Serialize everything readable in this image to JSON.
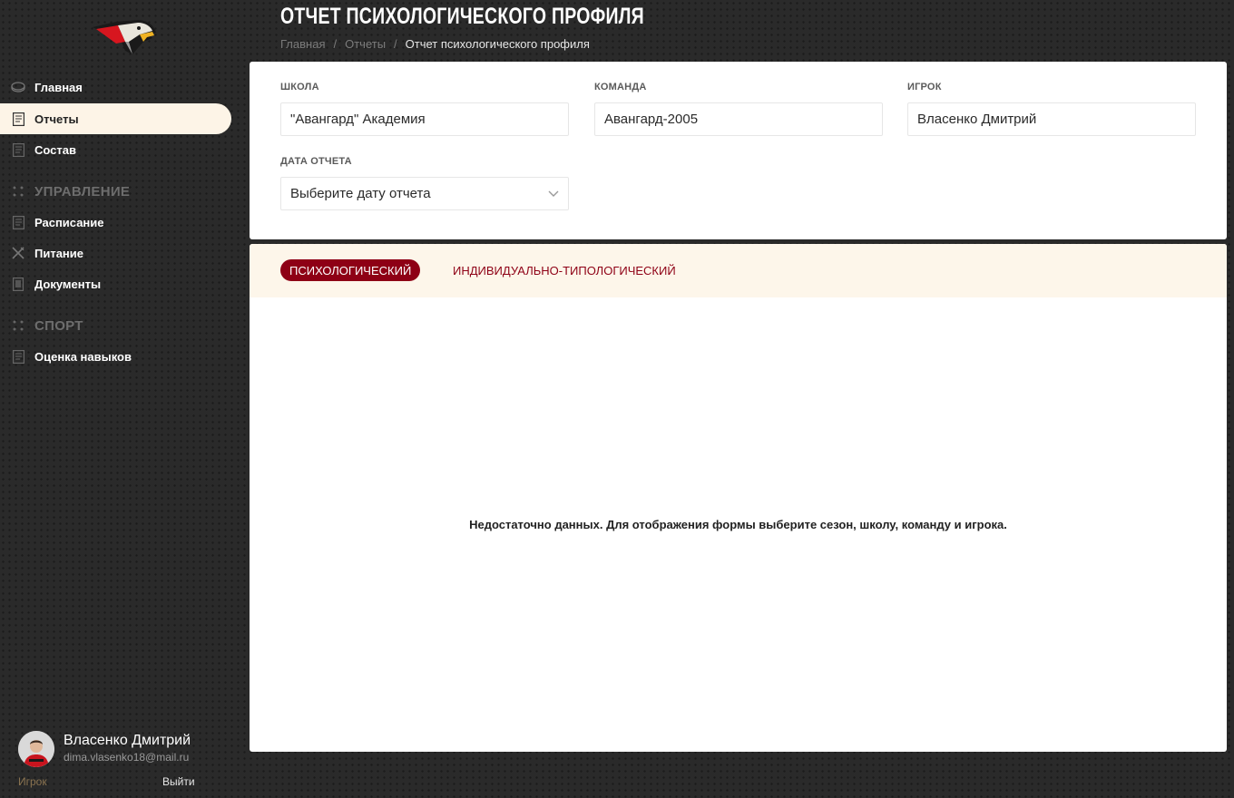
{
  "sidebar": {
    "items": [
      {
        "label": "Главная",
        "icon": "puck-icon"
      },
      {
        "label": "Отчеты",
        "icon": "report-icon",
        "active": true
      },
      {
        "label": "Состав",
        "icon": "document-icon"
      }
    ],
    "sections": [
      {
        "title": "УПРАВЛЕНИЕ",
        "items": [
          {
            "label": "Расписание",
            "icon": "document-icon"
          },
          {
            "label": "Питание",
            "icon": "cutlery-icon"
          },
          {
            "label": "Документы",
            "icon": "folder-icon"
          }
        ]
      },
      {
        "title": "СПОРТ",
        "items": [
          {
            "label": "Оценка навыков",
            "icon": "document-icon"
          }
        ]
      }
    ]
  },
  "user": {
    "name": "Власенко Дмитрий",
    "email": "dima.vlasenko18@mail.ru",
    "role": "Игрок",
    "logout_label": "Выйти"
  },
  "header": {
    "title": "ОТЧЕТ ПСИХОЛОГИЧЕСКОГО ПРОФИЛЯ",
    "breadcrumb": [
      "Главная",
      "Отчеты",
      "Отчет психологического профиля"
    ],
    "breadcrumb_separator": "/"
  },
  "filters": {
    "school": {
      "label": "ШКОЛА",
      "value": "\"Авангард\" Академия"
    },
    "team": {
      "label": "КОМАНДА",
      "value": "Авангард-2005"
    },
    "player": {
      "label": "ИГРОК",
      "value": "Власенко Дмитрий"
    },
    "report_date": {
      "label": "ДАТА ОТЧЕТА",
      "placeholder": "Выберите дату отчета"
    }
  },
  "tabs": [
    {
      "label": "ПСИХОЛОГИЧЕСКИЙ",
      "active": true
    },
    {
      "label": "ИНДИВИДУАЛЬНО-ТИПОЛОГИЧЕСКИЙ",
      "active": false
    }
  ],
  "empty_message": "Недостаточно данных. Для отображения формы выберите сезон, школу, команду и игрока.",
  "colors": {
    "accent": "#8e0015",
    "active_nav_bg": "#fdf4e7",
    "tabs_bg": "#fdf6ea",
    "background": "#2a2a2a"
  }
}
